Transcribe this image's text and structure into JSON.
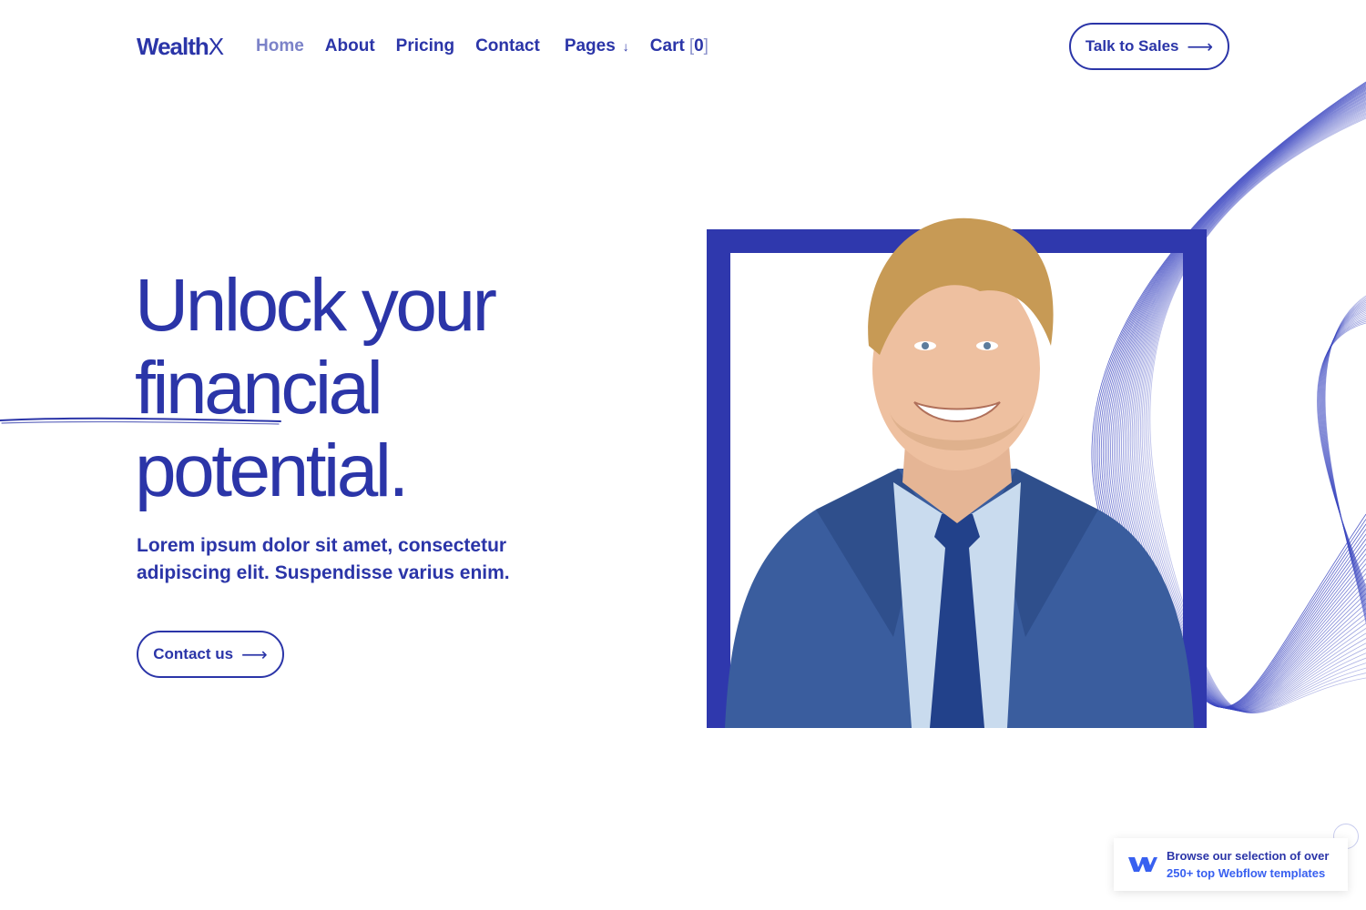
{
  "nav": {
    "logo_main": "Wealth",
    "logo_x": "X",
    "items": [
      {
        "label": "Home",
        "active": true
      },
      {
        "label": "About"
      },
      {
        "label": "Pricing"
      },
      {
        "label": "Contact"
      },
      {
        "label": "Pages",
        "icon": "chevron-down-icon"
      }
    ],
    "cart_label": "Cart",
    "cart_open": "[",
    "cart_count": "0",
    "cart_close": "]",
    "cta_label": "Talk to Sales",
    "cta_icon": "arrow-right-icon"
  },
  "hero": {
    "title_line1": "Unlock your",
    "title_line2": "financial",
    "title_line3": "potential.",
    "subtitle": "Lorem ipsum dolor sit amet, consectetur adipiscing elit. Suspendisse varius enim.",
    "button_label": "Contact us",
    "button_icon": "arrow-right-icon"
  },
  "badge": {
    "line1": "Browse our selection of over",
    "line2": "250+ top Webflow templates",
    "icon": "webflow-logo-icon"
  },
  "colors": {
    "brand": "#2b35a8",
    "frame": "#2f38ad",
    "active_nav": "#7b82c8",
    "badge_link": "#3860f0"
  }
}
